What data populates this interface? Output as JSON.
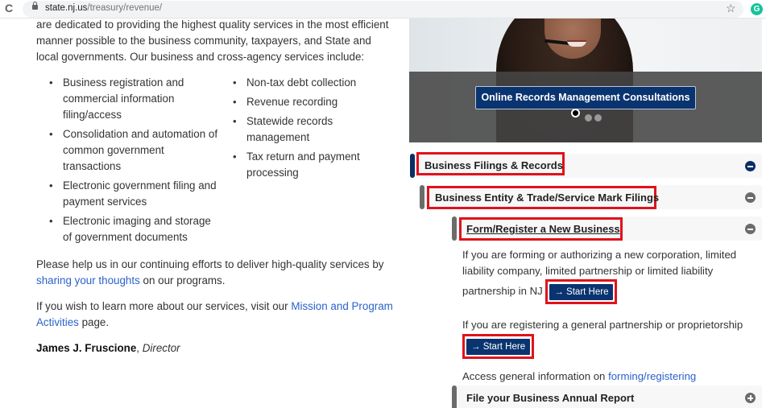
{
  "browser": {
    "reload_icon": "reload-icon",
    "url_domain": "state.nj.us",
    "url_path": "/treasury/revenue/",
    "bookmark_icon": "star-icon",
    "extension_icon": "grammarly-icon",
    "extension_letter": "G"
  },
  "left": {
    "intro": "are dedicated to providing the highest quality services in the most efficient manner possible to the business community, taxpayers, and State and local governments. Our business and cross-agency services include:",
    "services_col1": [
      "Business registration and commercial information filing/access",
      "Consolidation and automation of common government transactions",
      "Electronic government filing and payment services",
      "Electronic imaging and storage of government documents"
    ],
    "services_col2": [
      "Non-tax debt collection",
      "Revenue recording",
      "Statewide records management",
      "Tax return and payment processing"
    ],
    "feedback": {
      "before": "Please help us in our continuing efforts to deliver high-quality services by ",
      "link": "sharing your thoughts",
      "after": " on our programs."
    },
    "mission": {
      "before": "If you wish to learn more about our services, visit our ",
      "link": "Mission and Program Activities",
      "after": " page."
    },
    "signature": {
      "name": "James J. Fruscione",
      "sep": ", ",
      "title": "Director"
    }
  },
  "hero": {
    "button_label": "Online Records Management Consultations",
    "slides_total": 3,
    "active_slide": 1
  },
  "accordion": {
    "level1": {
      "title": "Business Filings & Records",
      "state": "expanded"
    },
    "level2": {
      "title": "Business Entity & Trade/Service Mark Filings",
      "state": "expanded"
    },
    "level3": {
      "title": "Form/Register a New Business",
      "state": "expanded",
      "p1": "If you are forming or authorizing a new corporation, limited liability company, limited partnership or limited liability partnership in NJ",
      "p2": "If you are registering a general partnership or proprietorship",
      "start_label": "→ Start Here",
      "p3_before": "Access general information on ",
      "p3_link": "forming/registering"
    },
    "level3b": {
      "title": "File your Business Annual Report",
      "state": "collapsed"
    }
  },
  "colors": {
    "navy": "#0a2f63",
    "button_navy": "#0a3470",
    "highlight_red": "#e0121b",
    "link_blue": "#2b62c9",
    "gray_bar": "#6b6b6b"
  }
}
